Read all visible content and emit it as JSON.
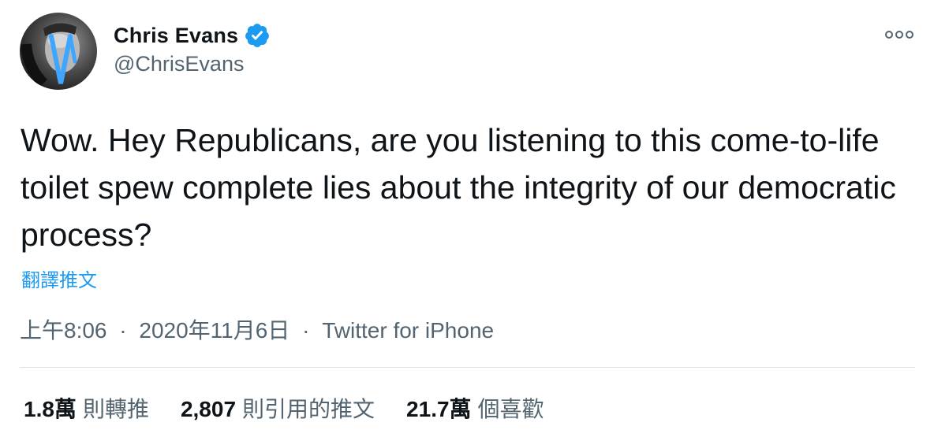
{
  "author": {
    "name": "Chris Evans",
    "handle": "@ChrisEvans",
    "verified": true,
    "verified_color": "#1d9bf0"
  },
  "tweet": {
    "text": "Wow. Hey Republicans, are you listening to this come-to-life toilet spew complete lies about the integrity of our democratic process?",
    "translate_label": "翻譯推文",
    "time": "上午8:06",
    "date": "2020年11月6日",
    "source": "Twitter for iPhone",
    "separator": "·"
  },
  "stats": {
    "retweets": {
      "count": "1.8萬",
      "label": "則轉推"
    },
    "quotes": {
      "count": "2,807",
      "label": "則引用的推文"
    },
    "likes": {
      "count": "21.7萬",
      "label": "個喜歡"
    }
  },
  "icons": {
    "verified": "verified-badge-icon",
    "more": "more-options-icon"
  },
  "colors": {
    "accent": "#1d9bf0",
    "text_primary": "#0f1419",
    "text_secondary": "#536471"
  }
}
